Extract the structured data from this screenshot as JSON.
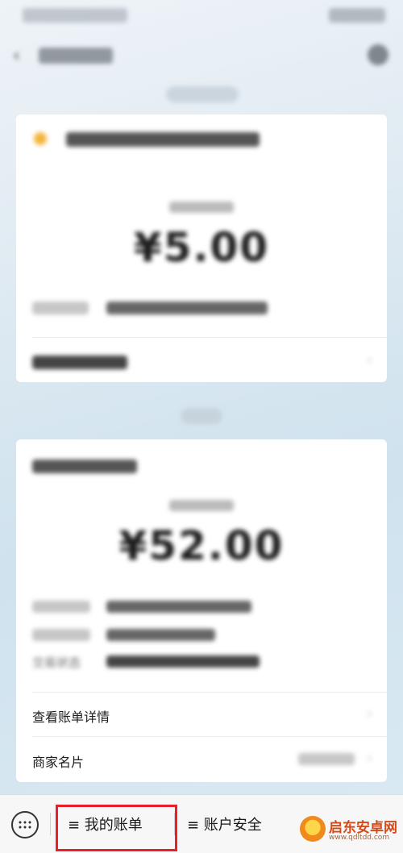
{
  "nav": {
    "back_icon": "chevron-left-icon",
    "settings_icon": "gear-icon"
  },
  "card1": {
    "amount": "¥5.00"
  },
  "card2": {
    "amount": "¥52.00",
    "status_label": "交易状态",
    "rows": [
      {
        "label": "查看账单详情"
      },
      {
        "label": "商家名片"
      }
    ]
  },
  "toolbar": {
    "keyboard_icon": "keyboard-icon",
    "items": [
      {
        "label": "≡ 我的账单"
      },
      {
        "label": "≡ 账户安全"
      }
    ]
  },
  "watermark": {
    "brand": "启东安卓网",
    "url": "www.qdltdd.com"
  },
  "colors": {
    "highlight": "#e8202a",
    "background": "#dfeaf2"
  }
}
